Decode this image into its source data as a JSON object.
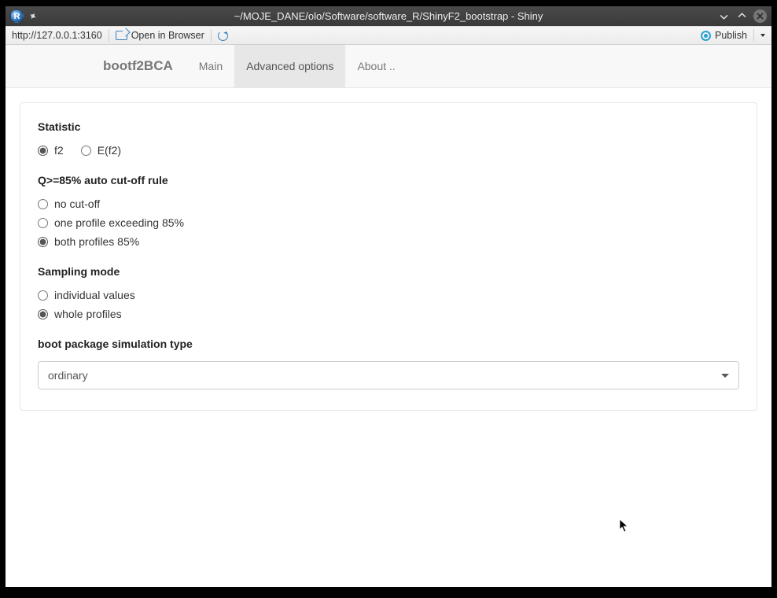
{
  "window": {
    "title": "~/MOJE_DANE/olo/Software/software_R/ShinyF2_bootstrap - Shiny",
    "app_letter": "R"
  },
  "toolbar": {
    "url": "http://127.0.0.1:3160",
    "open_in_browser": "Open in Browser",
    "publish": "Publish"
  },
  "navbar": {
    "brand": "bootf2BCA",
    "tabs": {
      "main": "Main",
      "advanced": "Advanced options",
      "about": "About .."
    }
  },
  "form": {
    "statistic": {
      "label": "Statistic",
      "f2": "f2",
      "ef2": "E(f2)"
    },
    "cutoff": {
      "label": "Q>=85% auto cut-off rule",
      "none": "no cut-off",
      "one": "one profile exceeding 85%",
      "both": "both profiles 85%"
    },
    "sampling": {
      "label": "Sampling mode",
      "individual": "individual values",
      "whole": "whole profiles"
    },
    "sim_type": {
      "label": "boot package simulation type",
      "selected": "ordinary"
    }
  }
}
